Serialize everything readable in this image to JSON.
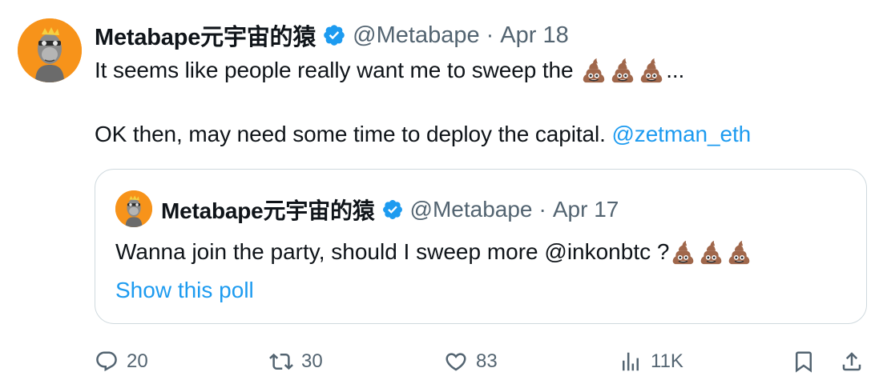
{
  "tweet": {
    "author_name": "Metabape元宇宙的猿",
    "handle": "@Metabape",
    "separator": "·",
    "date": "Apr 18",
    "line1_text": "It seems like people really want me to sweep the ",
    "line1_suffix": "...",
    "line2_text": "OK then, may need some time to deploy the capital. ",
    "line2_mention": "@zetman_eth",
    "emoji_name": "pile-of-poo"
  },
  "quote": {
    "author_name": "Metabape元宇宙的猿",
    "handle": "@Metabape",
    "separator": "·",
    "date": "Apr 17",
    "text": "Wanna join the party, should I sweep more @inkonbtc ?",
    "show_poll": "Show this poll"
  },
  "actions": {
    "replies": "20",
    "retweets": "30",
    "likes": "83",
    "views": "11K"
  },
  "colors": {
    "accent": "#1d9bf0",
    "secondary_text": "#536471",
    "border": "#cfd9de",
    "avatar_bg": "#f7931a"
  }
}
